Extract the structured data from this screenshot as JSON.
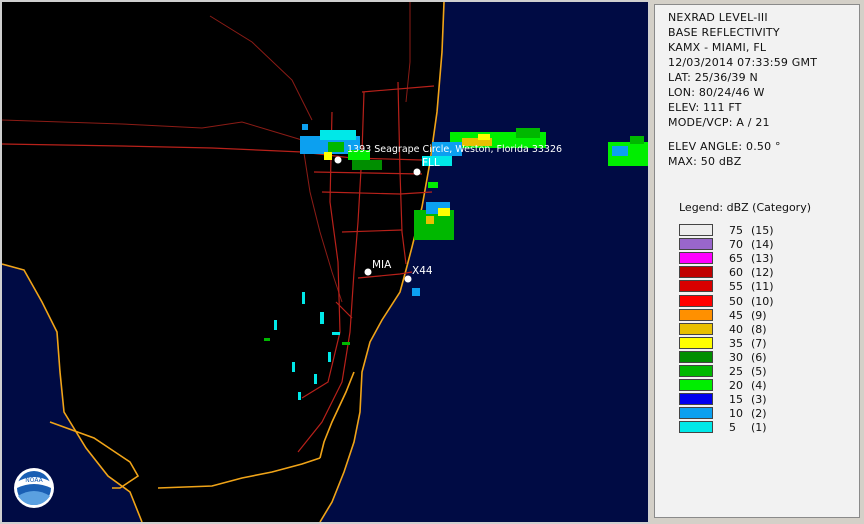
{
  "map": {
    "places": [
      {
        "name": "pin-address",
        "label": "1393 Seagrape Circle, Weston, Florida 33326"
      },
      {
        "name": "station-fll",
        "label": "FLL"
      },
      {
        "name": "station-mia",
        "label": "MIA"
      },
      {
        "name": "station-x44",
        "label": "X44"
      }
    ],
    "colors": {
      "ocean": "#000b44",
      "land": "#000000",
      "roads": "#b8211a",
      "coast": "#f0a418",
      "county": "#8c1c16"
    },
    "logo_text": "NOAA"
  },
  "info": {
    "product": "NEXRAD LEVEL-III",
    "type": "BASE REFLECTIVITY",
    "station": "KAMX - MIAMI, FL",
    "datetime": "12/03/2014 07:33:59 GMT",
    "lat": "LAT: 25/36/39 N",
    "lon": "LON: 80/24/46 W",
    "elev": "ELEV: 111 FT",
    "mode": "MODE/VCP: A / 21",
    "elev_angle": "ELEV ANGLE: 0.50 °",
    "max": "MAX: 50 dBZ"
  },
  "legend": {
    "title": "Legend: dBZ (Category)",
    "entries": [
      {
        "dbz": "75",
        "cat": "(15)",
        "color": "#eeeeee"
      },
      {
        "dbz": "70",
        "cat": "(14)",
        "color": "#9966cc"
      },
      {
        "dbz": "65",
        "cat": "(13)",
        "color": "#ff00ff"
      },
      {
        "dbz": "60",
        "cat": "(12)",
        "color": "#c00000"
      },
      {
        "dbz": "55",
        "cat": "(11)",
        "color": "#d80000"
      },
      {
        "dbz": "50",
        "cat": "(10)",
        "color": "#ff0000"
      },
      {
        "dbz": "45",
        "cat": "(9)",
        "color": "#ff9000"
      },
      {
        "dbz": "40",
        "cat": "(8)",
        "color": "#e8c000"
      },
      {
        "dbz": "35",
        "cat": "(7)",
        "color": "#ffff00"
      },
      {
        "dbz": "30",
        "cat": "(6)",
        "color": "#008e00"
      },
      {
        "dbz": "25",
        "cat": "(5)",
        "color": "#00b800"
      },
      {
        "dbz": "20",
        "cat": "(4)",
        "color": "#00ee00"
      },
      {
        "dbz": "15",
        "cat": "(3)",
        "color": "#0000ee"
      },
      {
        "dbz": "10",
        "cat": "(2)",
        "color": "#0ca0f0"
      },
      {
        "dbz": "5",
        "cat": "(1)",
        "color": "#00e8e8"
      }
    ]
  }
}
